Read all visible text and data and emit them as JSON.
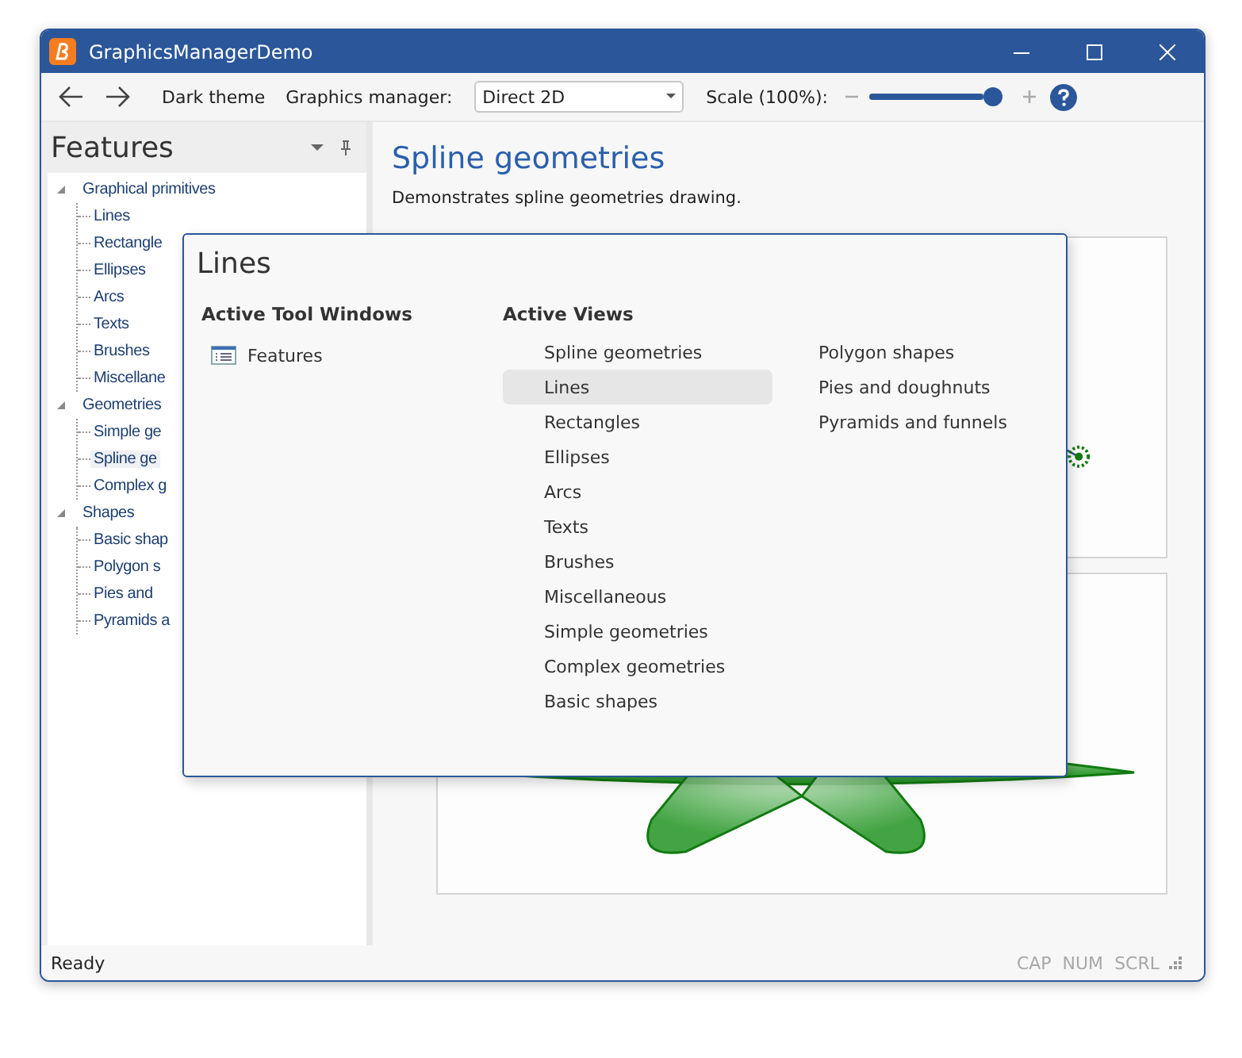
{
  "window": {
    "title": "GraphicsManagerDemo"
  },
  "toolbar": {
    "dark_theme": "Dark theme",
    "graphics_manager_label": "Graphics manager:",
    "graphics_manager": "Direct 2D",
    "scale_label": "Scale (100%):",
    "scale": {
      "level": 1.0
    }
  },
  "sidebar": {
    "title": "Features",
    "tree": [
      {
        "label": "Graphical primitives",
        "expanded": true,
        "selected": false,
        "children": [
          {
            "label": "Lines",
            "selected": false
          },
          {
            "label": "Rectangle",
            "selected": false
          },
          {
            "label": "Ellipses",
            "selected": false
          },
          {
            "label": "Arcs",
            "selected": false
          },
          {
            "label": "Texts",
            "selected": false
          },
          {
            "label": "Brushes",
            "selected": false
          },
          {
            "label": "Miscellane",
            "selected": false
          }
        ]
      },
      {
        "label": "Geometries",
        "expanded": true,
        "selected": false,
        "children": [
          {
            "label": "Simple ge",
            "selected": false
          },
          {
            "label": "Spline ge",
            "selected": true
          },
          {
            "label": "Complex g",
            "selected": false
          }
        ]
      },
      {
        "label": "Shapes",
        "expanded": true,
        "selected": false,
        "children": [
          {
            "label": "Basic shap",
            "selected": false
          },
          {
            "label": "Polygon s",
            "selected": false
          },
          {
            "label": "Pies and",
            "selected": false
          },
          {
            "label": "Pyramids a",
            "selected": false
          }
        ]
      }
    ]
  },
  "content": {
    "title": "Spline geometries",
    "description": "Demonstrates spline geometries drawing."
  },
  "switcher": {
    "title": "Lines",
    "tool_windows_heading": "Active Tool Windows",
    "tool_windows": [
      {
        "label": "Features"
      }
    ],
    "views_heading": "Active Views",
    "views": [
      {
        "label": "Spline geometries",
        "selected": false
      },
      {
        "label": "Lines",
        "selected": true
      },
      {
        "label": "Rectangles",
        "selected": false
      },
      {
        "label": "Ellipses",
        "selected": false
      },
      {
        "label": "Arcs",
        "selected": false
      },
      {
        "label": "Texts",
        "selected": false
      },
      {
        "label": "Brushes",
        "selected": false
      },
      {
        "label": "Miscellaneous",
        "selected": false
      },
      {
        "label": "Simple geometries",
        "selected": false
      },
      {
        "label": "Complex geometries",
        "selected": false
      },
      {
        "label": "Basic shapes",
        "selected": false
      },
      {
        "label": "Polygon shapes",
        "selected": false
      },
      {
        "label": "Pies and doughnuts",
        "selected": false
      },
      {
        "label": "Pyramids and funnels",
        "selected": false
      }
    ]
  },
  "status_bar": {
    "text": "Ready",
    "indicators": [
      {
        "label": "CAP",
        "on": false
      },
      {
        "label": "NUM",
        "on": false
      },
      {
        "label": "SCRL",
        "on": false
      }
    ]
  }
}
